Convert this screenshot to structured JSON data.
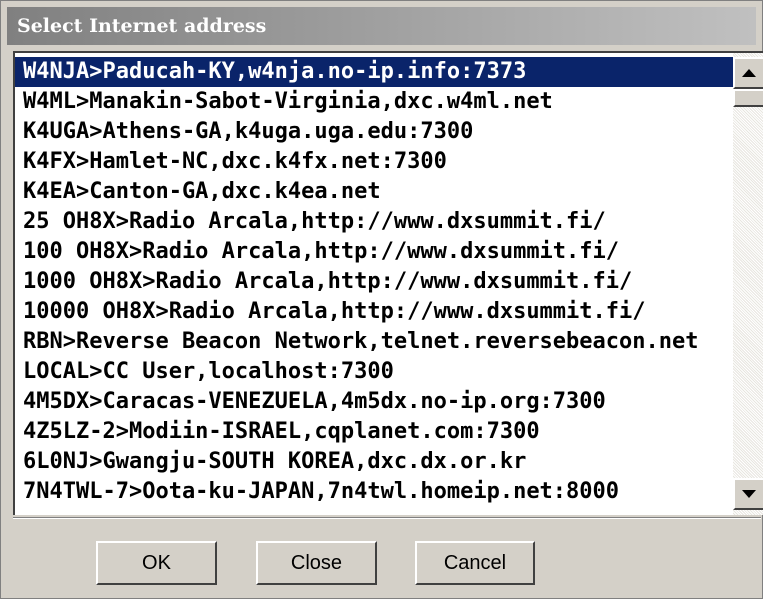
{
  "dialog": {
    "title": "Select Internet address"
  },
  "list": {
    "selected_index": 0,
    "items": [
      "W4NJA>Paducah-KY,w4nja.no-ip.info:7373",
      "W4ML>Manakin-Sabot-Virginia,dxc.w4ml.net",
      "K4UGA>Athens-GA,k4uga.uga.edu:7300",
      "K4FX>Hamlet-NC,dxc.k4fx.net:7300",
      "K4EA>Canton-GA,dxc.k4ea.net",
      "25 OH8X>Radio Arcala,http://www.dxsummit.fi/",
      "100 OH8X>Radio Arcala,http://www.dxsummit.fi/",
      "1000 OH8X>Radio Arcala,http://www.dxsummit.fi/",
      "10000 OH8X>Radio Arcala,http://www.dxsummit.fi/",
      "RBN>Reverse Beacon Network,telnet.reversebeacon.net",
      "LOCAL>CC User,localhost:7300",
      "4M5DX>Caracas-VENEZUELA,4m5dx.no-ip.org:7300",
      "4Z5LZ-2>Modiin-ISRAEL,cqplanet.com:7300",
      "6L0NJ>Gwangju-SOUTH KOREA,dxc.dx.or.kr",
      "7N4TWL-7>Oota-ku-JAPAN,7n4twl.homeip.net:8000"
    ]
  },
  "buttons": {
    "ok": "OK",
    "close": "Close",
    "cancel": "Cancel"
  },
  "colors": {
    "selection": "#0a246a",
    "face": "#d4d0c8"
  }
}
